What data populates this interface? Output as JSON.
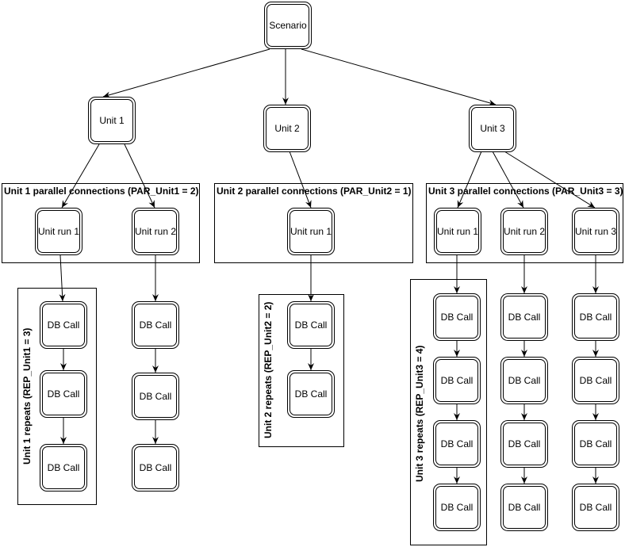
{
  "root": {
    "label": "Scenario"
  },
  "units": [
    {
      "label": "Unit 1",
      "parallel_title": "Unit 1 parallel connections (PAR_Unit1 = 2)",
      "repeats_title": "Unit 1 repeats (REP_Unit1 = 3)",
      "runs": [
        "Unit run 1",
        "Unit run 2"
      ]
    },
    {
      "label": "Unit 2",
      "parallel_title": "Unit 2 parallel connections (PAR_Unit2 = 1)",
      "repeats_title": "Unit 2 repeats (REP_Unit2 = 2)",
      "runs": [
        "Unit run 1"
      ]
    },
    {
      "label": "Unit 3",
      "parallel_title": "Unit 3 parallel connections (PAR_Unit3 = 3)",
      "repeats_title": "Unit 3 repeats (REP_Unit3 = 4)",
      "runs": [
        "Unit run 1",
        "Unit run 2",
        "Unit run 3"
      ]
    }
  ],
  "db_call_label": "DB Call"
}
